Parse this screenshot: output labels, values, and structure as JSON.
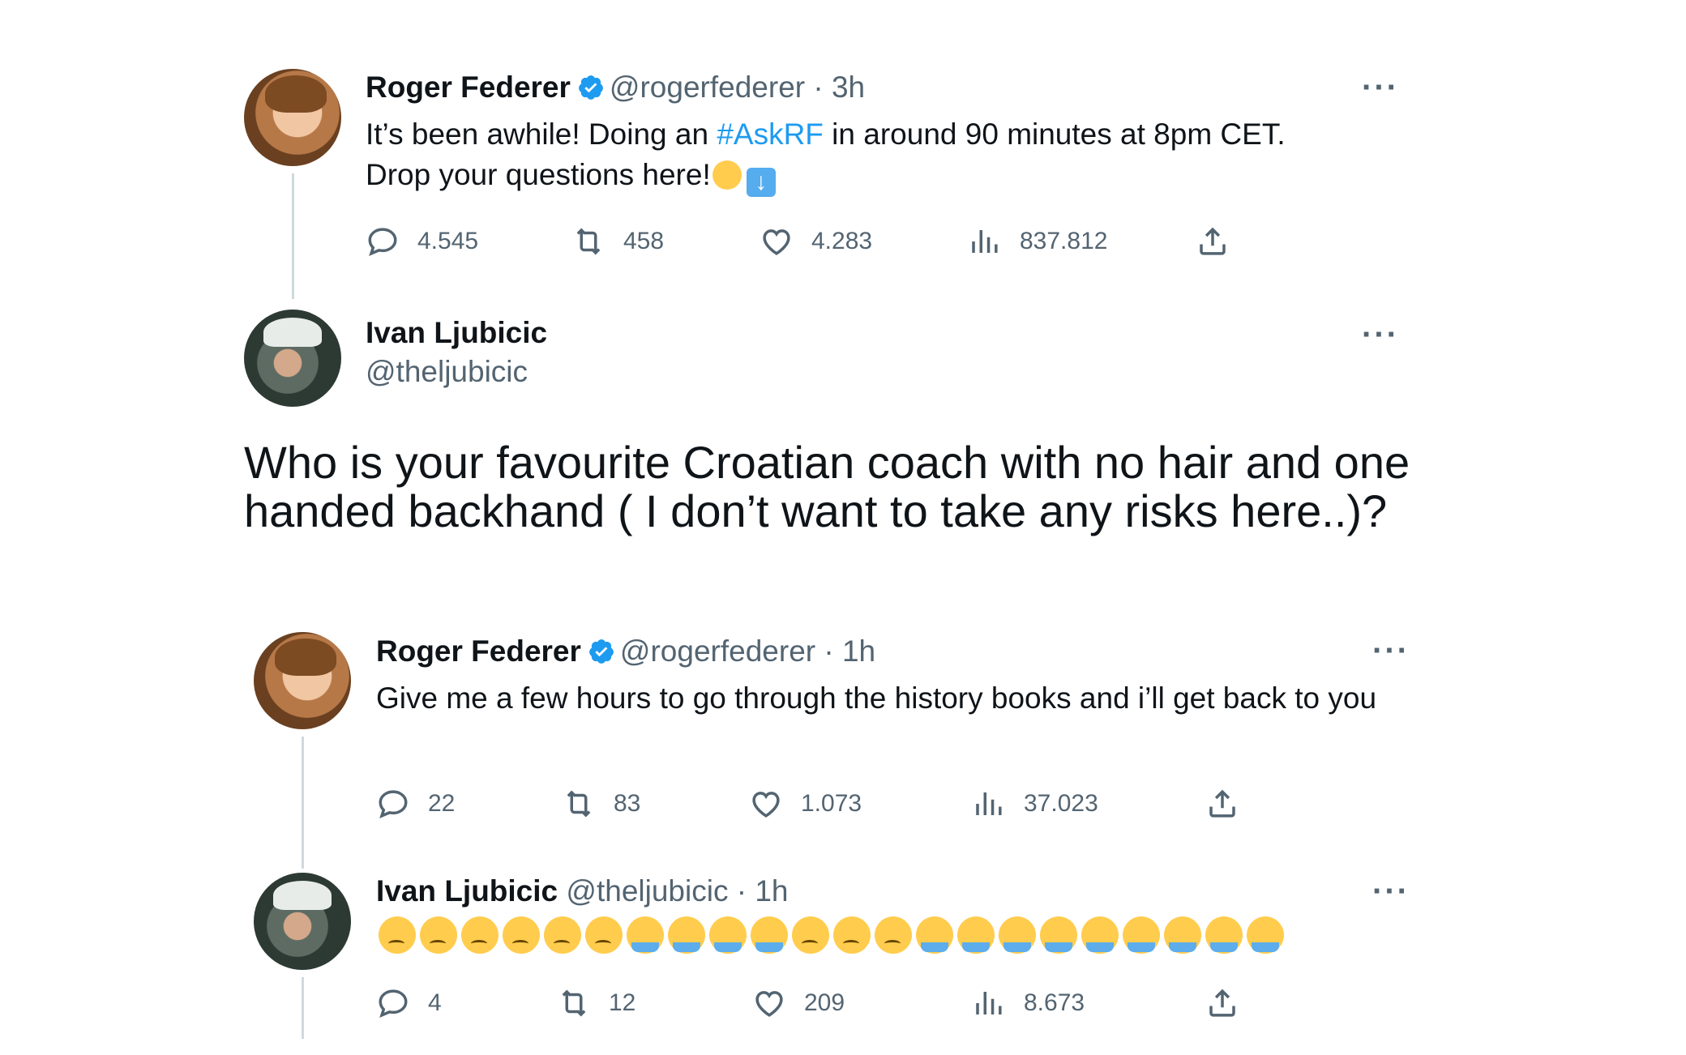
{
  "tweets": [
    {
      "name": "Roger Federer",
      "handle": "@rogerfederer",
      "sep": "·",
      "time": "3h",
      "text_line1_before": "It’s been awhile! Doing an ",
      "hashtag": "#AskRF",
      "text_line1_after": " in around 90 minutes at 8pm CET.",
      "text_line2": "Drop your questions here!",
      "stats": {
        "replies": "4.545",
        "retweets": "458",
        "likes": "4.283",
        "views": "837.812"
      }
    },
    {
      "name": "Ivan Ljubicic",
      "handle": "@theljubicic",
      "text": "Who is your favourite Croatian coach with no hair and one handed backhand ( I don’t want to take any risks here..)?"
    },
    {
      "name": "Roger Federer",
      "handle": "@rogerfederer",
      "sep": "·",
      "time": "1h",
      "text": "Give me a few hours to go through the history books and i’ll get back to you",
      "stats": {
        "replies": "22",
        "retweets": "83",
        "likes": "1.073",
        "views": "37.023"
      }
    },
    {
      "name": "Ivan Ljubicic",
      "handle": "@theljubicic",
      "sep": "·",
      "time": "1h",
      "emojis": [
        "sad",
        "sad",
        "sad",
        "sad",
        "sad",
        "sad",
        "cry",
        "cry",
        "cry",
        "cry",
        "sad",
        "sad",
        "sad",
        "cry",
        "cry",
        "cry",
        "cry",
        "cry",
        "cry",
        "cry",
        "cry",
        "cry"
      ],
      "stats": {
        "replies": "4",
        "retweets": "12",
        "likes": "209",
        "views": "8.673"
      }
    }
  ],
  "icons": {
    "reply": "reply-icon",
    "retweet": "retweet-icon",
    "like": "heart-icon",
    "views": "views-icon",
    "share": "share-icon",
    "more": "more-icon",
    "verified": "verified-icon"
  },
  "more_label": "···",
  "colors": {
    "link": "#1d9bf0",
    "muted": "#536471",
    "text": "#0f1419",
    "verified": "#1d9bf0"
  }
}
